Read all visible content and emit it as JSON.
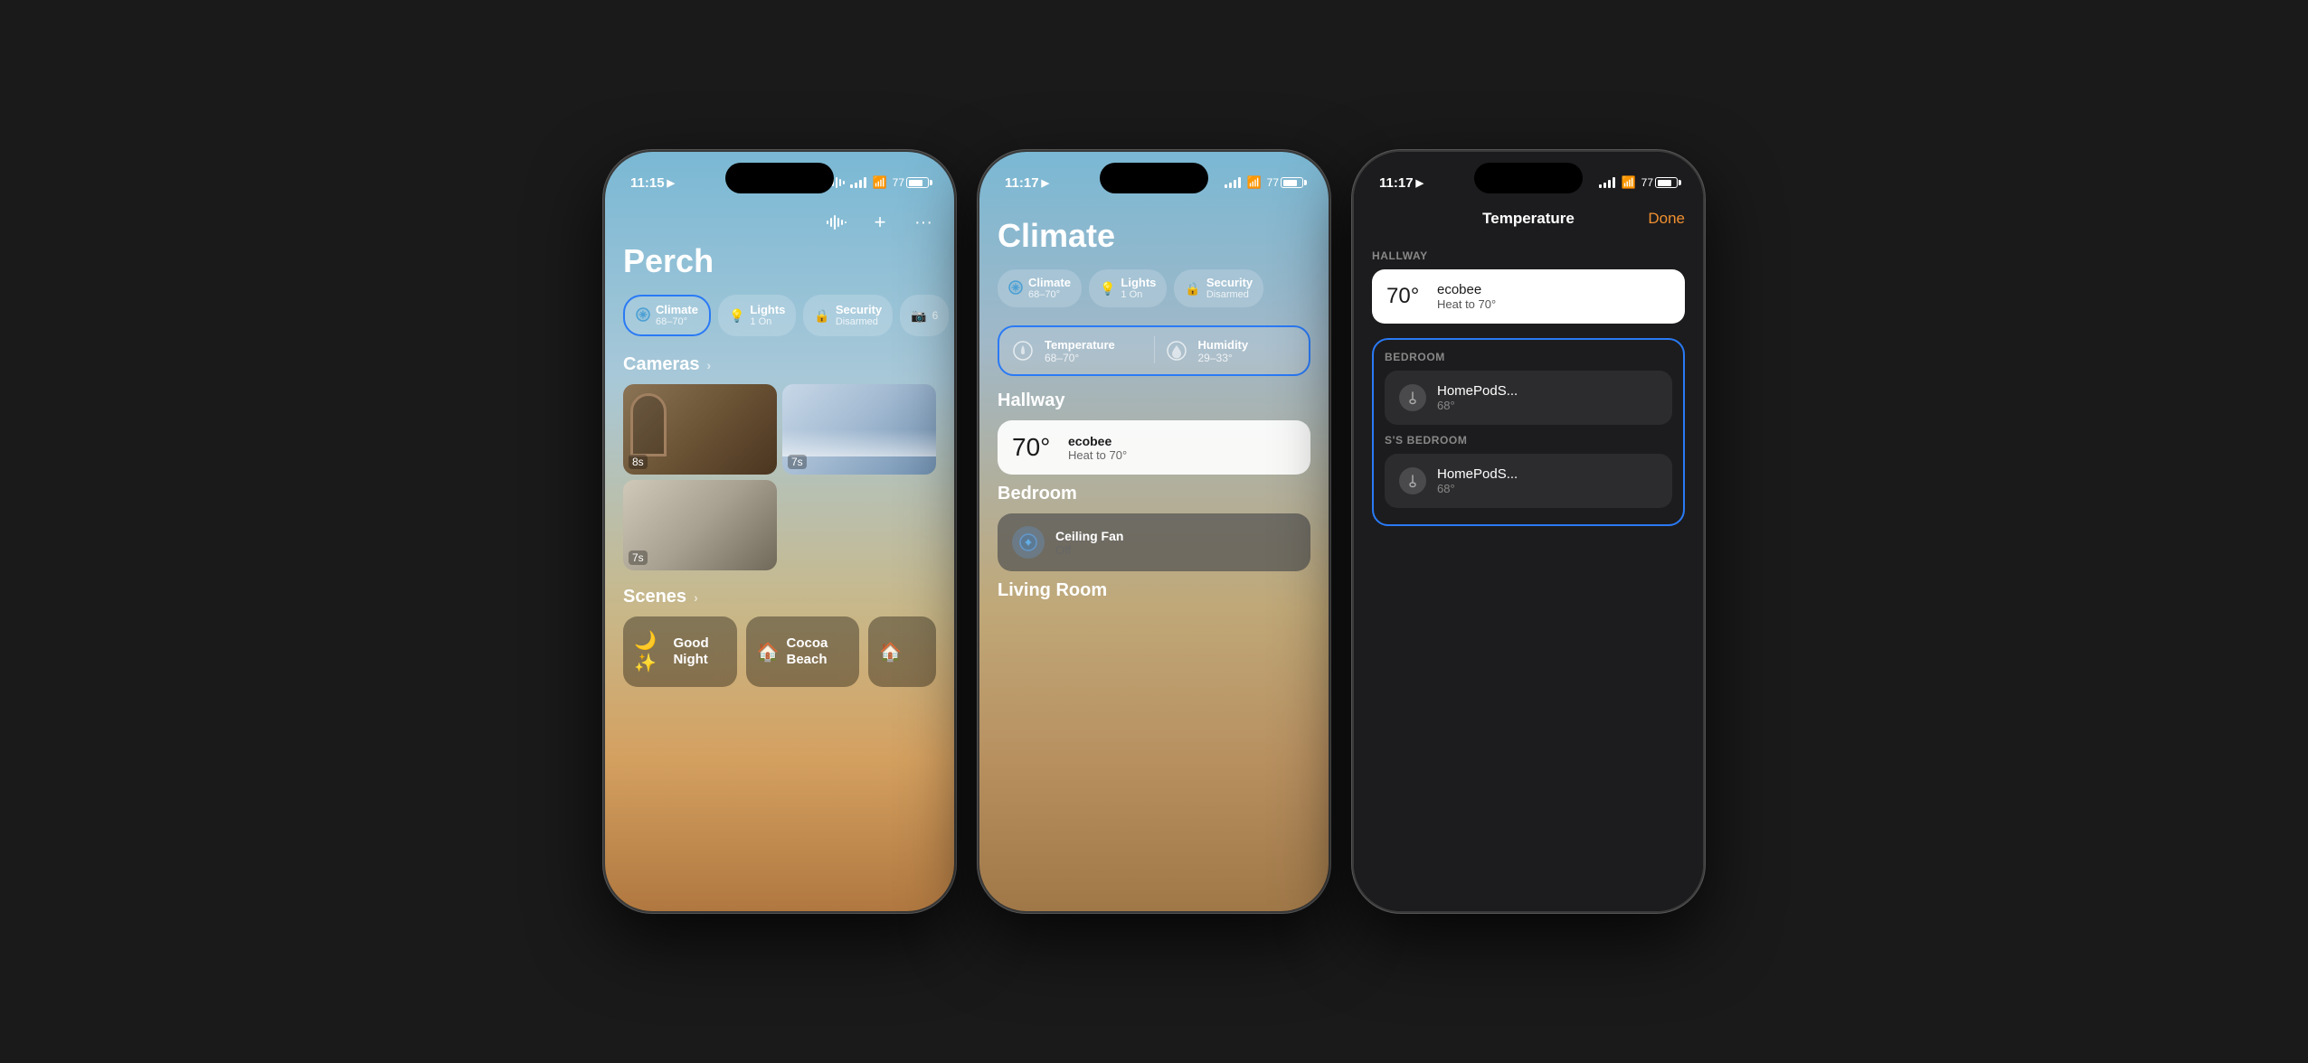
{
  "phones": [
    {
      "id": "phone1",
      "status": {
        "time": "11:15",
        "battery": "77"
      },
      "title": "Perch",
      "toolbar": {
        "waveform": "waveform-icon",
        "plus": "+",
        "dots": "⋯"
      },
      "pills": [
        {
          "icon": "❄️",
          "label": "Climate",
          "sub": "68–70°",
          "active": true
        },
        {
          "icon": "💡",
          "label": "Lights",
          "sub": "1 On",
          "active": false
        },
        {
          "icon": "🔒",
          "label": "Security",
          "sub": "Disarmed",
          "active": false
        },
        {
          "icon": "📷",
          "label": "",
          "sub": "6",
          "active": false
        }
      ],
      "cameras_label": "Cameras",
      "cameras": [
        {
          "timer": "8s",
          "type": "cam1"
        },
        {
          "timer": "7s",
          "type": "cam2"
        },
        {
          "timer": "7s",
          "type": "cam3"
        }
      ],
      "scenes_label": "Scenes",
      "scenes": [
        {
          "icon": "🌙",
          "label": "Good Night"
        },
        {
          "icon": "🏠",
          "label": "Cocoa Beach"
        },
        {
          "icon": "🏠",
          "label": ""
        }
      ]
    },
    {
      "id": "phone2",
      "status": {
        "time": "11:17",
        "battery": "77"
      },
      "title": "Climate",
      "pills": [
        {
          "icon": "❄️",
          "label": "Climate",
          "sub": "68–70°",
          "active": false
        },
        {
          "icon": "💡",
          "label": "Lights",
          "sub": "1 On",
          "active": false
        },
        {
          "icon": "🔒",
          "label": "Security",
          "sub": "Disarmed",
          "active": false
        }
      ],
      "temp_card": {
        "label": "Temperature",
        "sub": "68–70°",
        "border": true
      },
      "humidity_card": {
        "label": "Humidity",
        "sub": "29–33°",
        "border": true
      },
      "rooms": [
        {
          "name": "Hallway",
          "devices": [
            {
              "type": "thermostat",
              "temp": "70°",
              "name": "ecobee",
              "sub": "Heat to 70°",
              "white": true
            }
          ]
        },
        {
          "name": "Bedroom",
          "devices": [
            {
              "type": "fan",
              "name": "Ceiling Fan",
              "sub": "Off",
              "white": false
            }
          ]
        },
        {
          "name": "Living Room",
          "devices": []
        }
      ]
    },
    {
      "id": "phone3",
      "status": {
        "time": "11:17",
        "battery": "77"
      },
      "header_title": "Temperature",
      "done_label": "Done",
      "sections": [
        {
          "room": "HALLWAY",
          "devices": [
            {
              "temp": "70°",
              "name": "ecobee",
              "sub": "Heat to 70°",
              "white": true
            }
          ]
        },
        {
          "room": "BEDROOM",
          "highlighted": true,
          "devices": [
            {
              "temp": "",
              "name": "HomePodS...",
              "sub": "68°",
              "white": false
            },
            {
              "temp": "",
              "name": "HomePodS...",
              "sub": "68°",
              "white": false,
              "room_label": "S'S BEDROOM"
            }
          ]
        }
      ]
    }
  ]
}
